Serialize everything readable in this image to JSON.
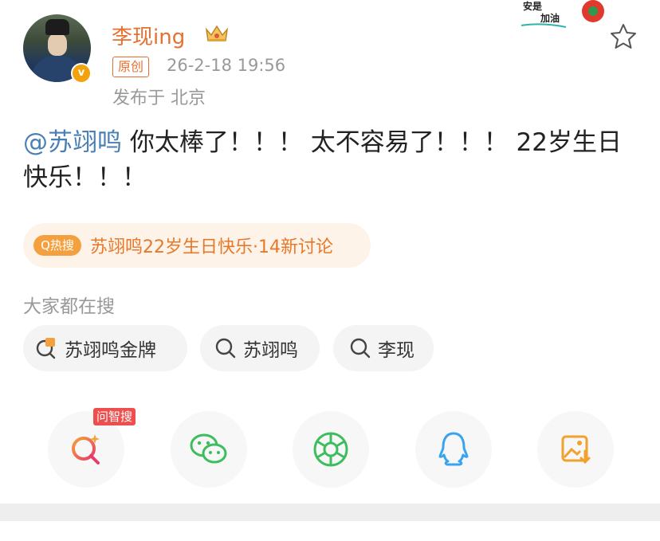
{
  "post": {
    "username": "李现ing",
    "original_badge": "原创",
    "time": "26-2-18 19:56",
    "location": "发布于 北京",
    "mention": "@苏翊鸣",
    "text": " 你太棒了！！！ 太不容易了！！！ 22岁生日快乐！！！"
  },
  "sticker": {
    "line1": "安是",
    "line2": "加油"
  },
  "hot_search": {
    "tag": "Q热搜",
    "text": "苏翊鸣22岁生日快乐·14新讨论"
  },
  "everyone_searching": {
    "heading": "大家都在搜",
    "chips": [
      {
        "label": "苏翊鸣金牌",
        "icon": "hot-search-icon"
      },
      {
        "label": "苏翊鸣",
        "icon": "search-icon"
      },
      {
        "label": "李现",
        "icon": "search-icon"
      }
    ]
  },
  "share_bar": {
    "ai_search_label": "问智搜",
    "buttons": [
      "ai-search-icon",
      "wechat-icon",
      "moments-icon",
      "qq-icon",
      "save-image-icon"
    ]
  },
  "colors": {
    "accent": "#e7702f",
    "mention": "#4a7fb5",
    "hot_bg": "#fdf3e8",
    "muted": "#999999"
  }
}
